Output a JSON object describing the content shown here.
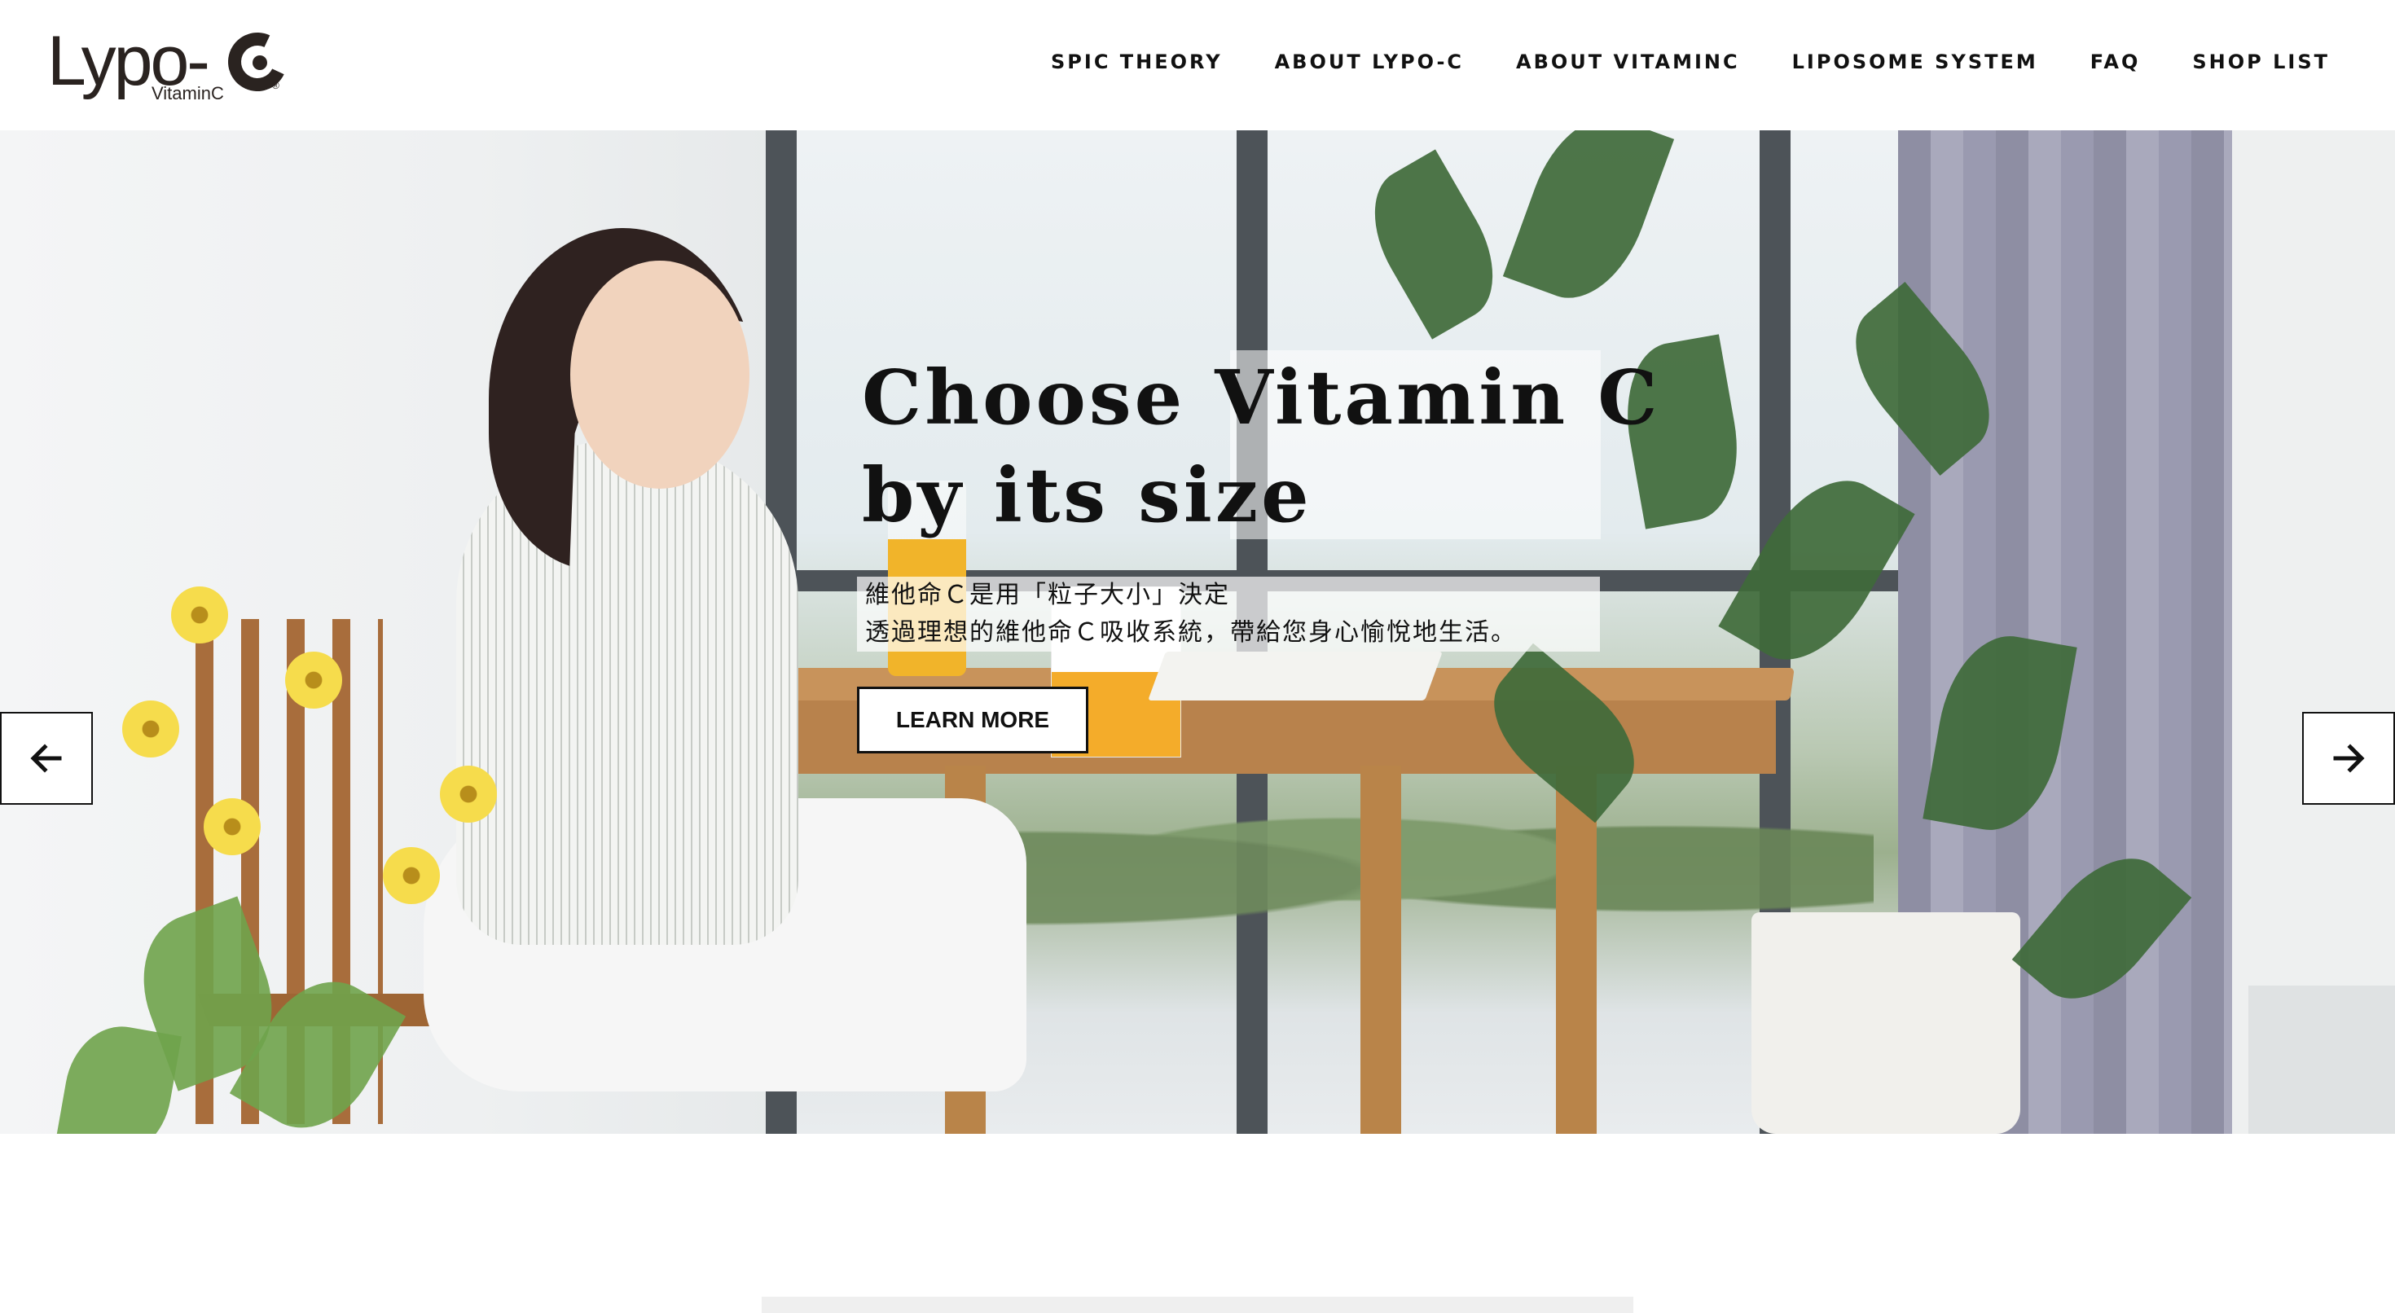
{
  "header": {
    "logo": {
      "main": "Lypo-",
      "sub": "VitaminC",
      "reg": "®"
    },
    "nav": [
      {
        "label": "SPIC THEORY"
      },
      {
        "label": "ABOUT LYPO-C"
      },
      {
        "label": "ABOUT VITAMINC"
      },
      {
        "label": "LIPOSOME SYSTEM"
      },
      {
        "label": "FAQ"
      },
      {
        "label": "SHOP LIST"
      }
    ]
  },
  "hero": {
    "title": "Choose Vitamin C\nby its size",
    "subtitle_line1": "維他命Ｃ是用「粒子大小」決定",
    "subtitle_line2": "透過理想的維他命Ｃ吸收系統，帶給您身心愉悅地生活。",
    "button_label": "LEARN MORE",
    "prev_icon": "arrow-left-icon",
    "next_icon": "arrow-right-icon",
    "slides": {
      "count": 3,
      "active": 2
    },
    "accent_color": "#f2b64b"
  }
}
